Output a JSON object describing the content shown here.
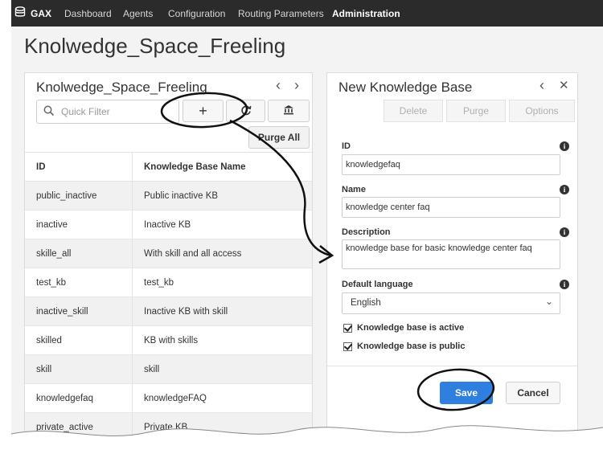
{
  "nav": {
    "brand": "GAX",
    "items": [
      {
        "label": "Dashboard",
        "active": false
      },
      {
        "label": "Agents",
        "active": false
      },
      {
        "label": "Configuration",
        "active": false
      },
      {
        "label": "Routing Parameters",
        "active": false
      },
      {
        "label": "Administration",
        "active": true
      }
    ]
  },
  "page": {
    "title": "Knolwedge_Space_Freeling"
  },
  "left_panel": {
    "title": "Knolwedge_Space_Freeling",
    "search_placeholder": "Quick Filter",
    "toolbar": {
      "add": "+",
      "purge_all": "Purge All"
    },
    "columns": [
      "ID",
      "Knowledge Base Name"
    ],
    "rows": [
      {
        "id": "public_inactive",
        "name": "Public inactive KB"
      },
      {
        "id": "inactive",
        "name": "Inactive KB"
      },
      {
        "id": "skille_all",
        "name": "With skill and all access"
      },
      {
        "id": "test_kb",
        "name": "test_kb"
      },
      {
        "id": "inactive_skill",
        "name": "Inactive KB with skill"
      },
      {
        "id": "skilled",
        "name": "KB with skills"
      },
      {
        "id": "skill",
        "name": "skill"
      },
      {
        "id": "knowledgefaq",
        "name": "knowledgeFAQ"
      },
      {
        "id": "private_active",
        "name": "Private KB"
      }
    ]
  },
  "right_panel": {
    "title": "New Knowledge Base",
    "actions": {
      "delete": "Delete",
      "purge": "Purge",
      "options": "Options"
    },
    "fields": {
      "id": {
        "label": "ID",
        "value": "knowledgefaq"
      },
      "name": {
        "label": "Name",
        "value": "knowledge center faq"
      },
      "description": {
        "label": "Description",
        "value": "knowledge base for basic knowledge center faq"
      },
      "language": {
        "label": "Default language",
        "value": "English"
      }
    },
    "checkboxes": {
      "active": {
        "label": "Knowledge base is active",
        "checked": true
      },
      "public": {
        "label": "Knowledge base is public",
        "checked": true
      }
    },
    "buttons": {
      "save": "Save",
      "cancel": "Cancel"
    }
  },
  "colors": {
    "nav_bg": "#2b2b2b",
    "primary": "#2f7fe0",
    "page_bg": "#f3f3f3"
  }
}
